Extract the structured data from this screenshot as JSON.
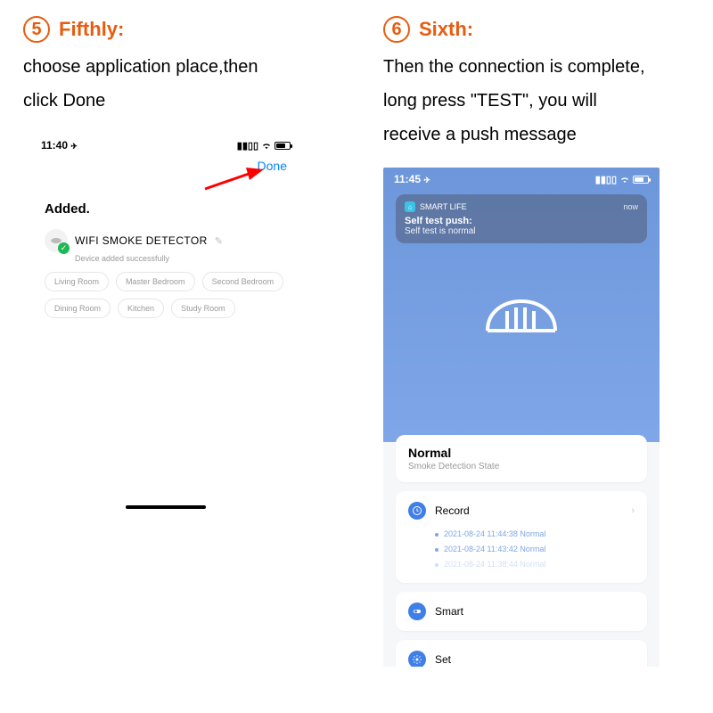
{
  "step5": {
    "number": "5",
    "label": "Fifthly:",
    "instruction_l1": "choose application place,then",
    "instruction_l2": "click Done"
  },
  "step6": {
    "number": "6",
    "label": "Sixth:",
    "instruction_l1": "Then the connection is complete,",
    "instruction_l2": "long press \"TEST\", you will",
    "instruction_l3": "receive a push message"
  },
  "phone_a": {
    "time": "11:40",
    "done": "Done",
    "added": "Added.",
    "device": "WIFI  SMOKE DETECTOR",
    "device_sub": "Device added successfully",
    "rooms": [
      "Living Room",
      "Master Bedroom",
      "Second Bedroom",
      "Dining Room",
      "Kitchen",
      "Study Room"
    ]
  },
  "phone_b": {
    "time": "11:45",
    "notif_app": "SMART LIFE",
    "notif_now": "now",
    "notif_title": "Self test push:",
    "notif_body": "Self test is normal",
    "state_title": "Normal",
    "state_sub": "Smoke Detection State",
    "record_label": "Record",
    "records": [
      "2021-08-24 11:44:38 Normal",
      "2021-08-24 11:43:42 Normal",
      "2021-08-24 11:38:44 Normal"
    ],
    "smart_label": "Smart",
    "set_label": "Set"
  }
}
